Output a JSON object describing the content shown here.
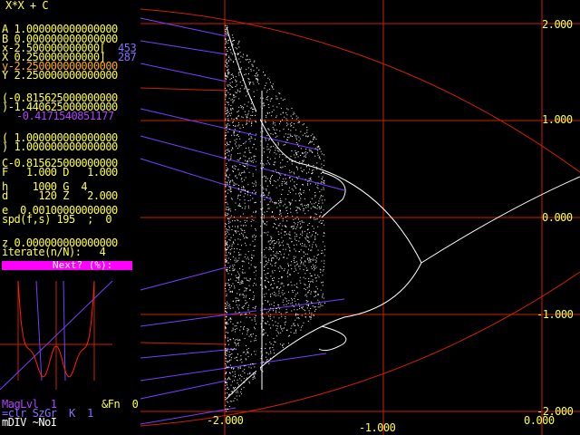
{
  "formula": "X*X + C",
  "params": {
    "A": "A 1.000000000000000",
    "B": "B 0.000000000000000",
    "x": "x-2.500000000000[",
    "x_px": "453",
    "X": "X 0.250000000000]",
    "X_px": "287",
    "y": "y-2.250000000000000",
    "Y": "Y 2.250000000000000"
  },
  "coords": {
    "open": "(-0.815625000000000",
    "close": ")-1.440625000000000",
    "result": "-0.4171540851177"
  },
  "pair": {
    "open": "( 1.000000000000000",
    "close": ") 1.000000000000000"
  },
  "cfd": {
    "C": "C-0.815625000000000",
    "FD": "F   1.000 D   1.000",
    "hG": "h    1000 G  4",
    "dZ": "d     120 Z   2.000",
    "e": "e  0.00100000000000",
    "spd": "spd(f,s) 195  ;  0",
    "z": "z 0.000000000000000",
    "iterate": "iterate(n/N):   4"
  },
  "prompt": "Next? (%):",
  "status": {
    "maglvl": "MagLvl  1",
    "fn": "&Fn  0",
    "clr": "=clr SzGr  K  1",
    "mdiv": "mDIV ~NoI"
  },
  "axes": {
    "x_ticks": [
      "-2.000",
      "-1.000",
      "0.000"
    ],
    "y_ticks": [
      "2.000",
      "1.000",
      "0.000",
      "-1.000",
      "-2.000"
    ]
  },
  "colors": {
    "background": "#000000",
    "param_text": "#ffff44",
    "axis": "#cc2200",
    "orbit_lines": "#7a3cff",
    "curve": "#ffffff",
    "prompt_bar": "#ff00ff"
  }
}
